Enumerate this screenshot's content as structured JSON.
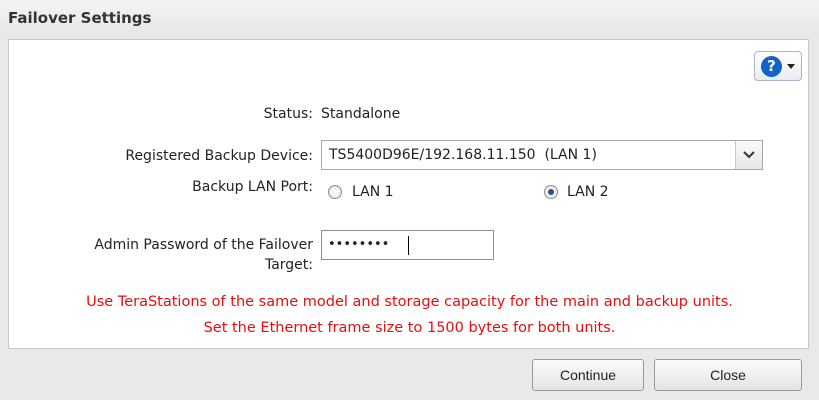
{
  "dialog": {
    "title": "Failover Settings"
  },
  "help": {
    "icon": "help-icon",
    "glyph": "?",
    "icon_color": "#1663c7"
  },
  "form": {
    "status_label": "Status:",
    "status_value": "Standalone",
    "device_label": "Registered Backup Device:",
    "device_value": "TS5400D96E/192.168.11.150  (LAN 1)",
    "port_label": "Backup LAN Port:",
    "port_options": [
      {
        "label": "LAN 1",
        "checked": false
      },
      {
        "label": "LAN 2",
        "checked": true
      }
    ],
    "password_label_line1": "Admin Password of the Failover",
    "password_label_line2": "Target:",
    "password_mask": "••••••••"
  },
  "messages": {
    "line1": "Use TeraStations of the same model and storage capacity for the main and backup units.",
    "line2": "Set the Ethernet frame size to 1500 bytes for both units.",
    "color": "#e01010"
  },
  "buttons": {
    "continue": "Continue",
    "close": "Close"
  }
}
